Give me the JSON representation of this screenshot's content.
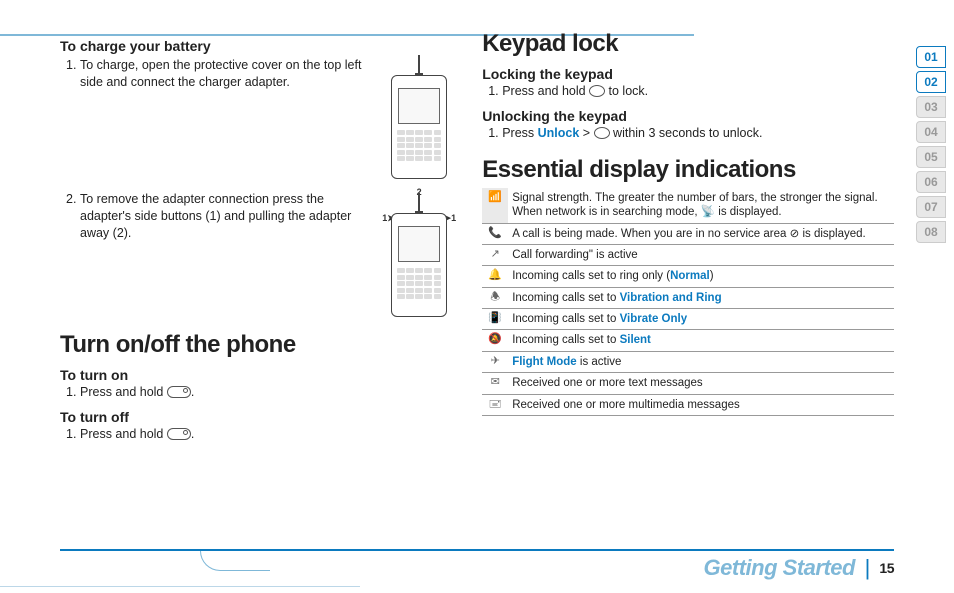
{
  "left": {
    "charge_heading": "To charge your battery",
    "charge_step1": "To charge, open the protective cover on the top left side and connect the charger adapter.",
    "charge_step2": "To remove the adapter connection press the adapter's side buttons (1) and pulling the adapter away (2).",
    "turn_heading": "Turn on/off the phone",
    "turn_on_h": "To turn on",
    "turn_on_step": "Press and hold ",
    "turn_off_h": "To turn off",
    "turn_off_step": "Press and hold ",
    "period": "."
  },
  "right": {
    "keypad_heading": "Keypad lock",
    "lock_h": "Locking the keypad",
    "lock_step_a": "Press and hold ",
    "lock_step_b": " to lock.",
    "unlock_h": "Unlocking the keypad",
    "unlock_step_a": "Press ",
    "unlock_link": "Unlock",
    "unlock_step_b": " > ",
    "unlock_step_c": " within 3 seconds to unlock.",
    "ess_heading": "Essential display indications"
  },
  "indicators": {
    "row1": "Signal strength. The greater the number of bars, the stronger the signal. When network is in searching mode, ",
    "row1b": " is displayed.",
    "row2a": "A call is being made. When you are in no service area ",
    "row2b": " is displayed.",
    "row3": "Call forwarding\" is active",
    "row4a": "Incoming calls set to ring only (",
    "row4link": "Normal",
    "row4b": ")",
    "row5a": "Incoming calls set to ",
    "row5link": "Vibration and Ring",
    "row6a": "Incoming calls set to ",
    "row6link": "Vibrate Only",
    "row7a": "Incoming calls set to ",
    "row7link": "Silent",
    "row8link": "Flight Mode",
    "row8b": " is active",
    "row9": "Received one or more text messages",
    "row10": "Received one or more multimedia messages"
  },
  "tabs": [
    "01",
    "02",
    "03",
    "04",
    "05",
    "06",
    "07",
    "08"
  ],
  "footer": {
    "section": "Getting Started",
    "page": "15"
  },
  "illus": {
    "arrow_left": "1➤",
    "arrow_right": "➤1",
    "top_label": "2"
  }
}
